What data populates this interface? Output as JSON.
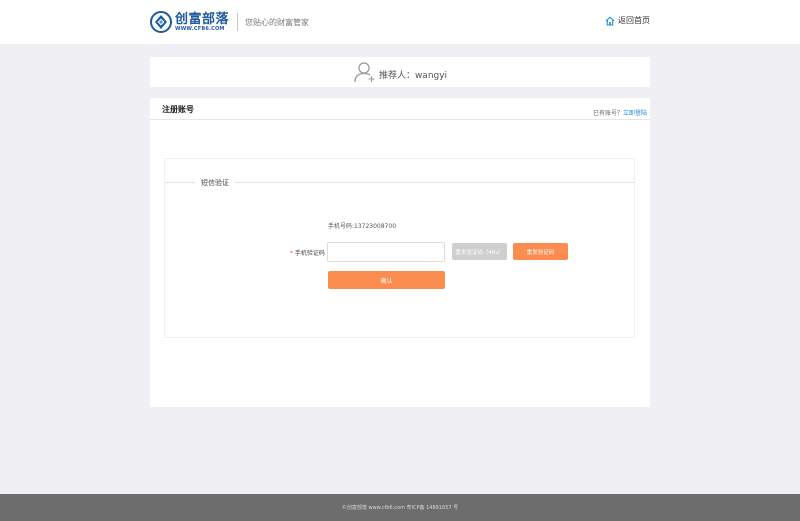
{
  "header": {
    "logo_name": "创富部落",
    "logo_url": "WWW.CFB6.COM",
    "slogan": "您贴心的财富管家",
    "home_label": "返回首页"
  },
  "referrer": {
    "text": "推荐人：wangyi"
  },
  "register": {
    "title": "注册账号",
    "have_account": "已有账号？",
    "login_link": "立即登陆"
  },
  "sms": {
    "legend": "短信验证",
    "phone_text": "手机号码:13723008700",
    "required_mark": "*",
    "code_label": "手机验证码",
    "code_value": "",
    "code_placeholder": "",
    "countdown_label": "重发验证码（46s）",
    "resend_label": "重发验证码",
    "confirm_label": "确认"
  },
  "footer": {
    "text": "©创富部落 www.cfb6.com 粤ICP备 14891657 号"
  },
  "colors": {
    "brand": "#1e5a9e",
    "accent": "#fb8c50",
    "link": "#1c8ad6",
    "disabled": "#cfcfcf",
    "background": "#efeff4"
  }
}
